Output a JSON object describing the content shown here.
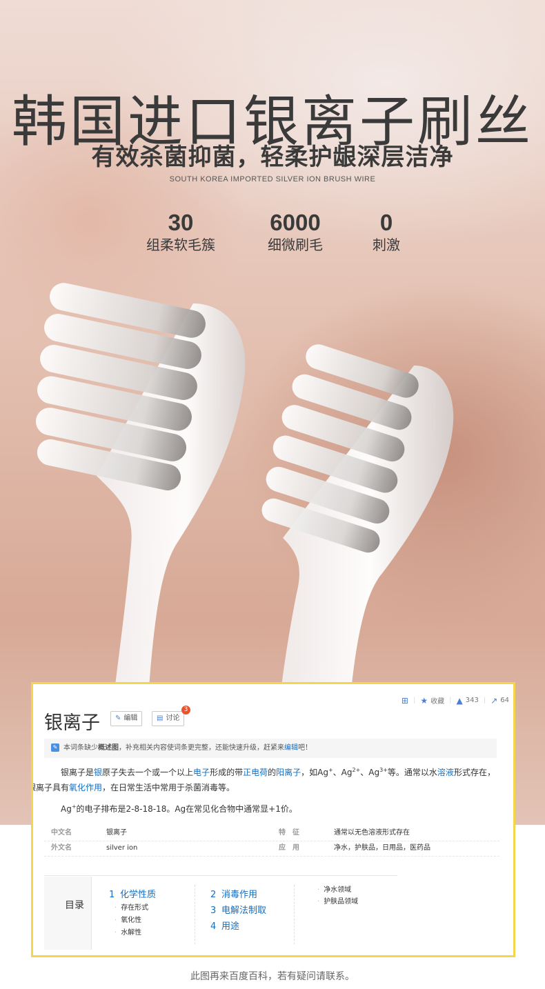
{
  "hero": {
    "headline": "韩国进口银离子刷丝",
    "subheadline": "有效杀菌抑菌，轻柔护龈深层洁净",
    "english_line": "SOUTH KOREA IMPORTED SILVER ION BRUSH WIRE",
    "stats": [
      {
        "value": "30",
        "label": "组柔软毛簇"
      },
      {
        "value": "6000",
        "label": "细微刷毛"
      },
      {
        "value": "0",
        "label": "刺激"
      }
    ]
  },
  "baike": {
    "toolbar": {
      "collect_label": "收藏",
      "likes": "343",
      "shares": "64"
    },
    "title": "银离子",
    "edit_label": "编辑",
    "discuss_label": "讨论",
    "discuss_badge": "3",
    "notice": {
      "p1": "本词条缺少",
      "p2": "概述图",
      "p3": "，补充相关内容使词条更完整，还能快速升级，赶紧来",
      "p4": "编辑",
      "p5": "吧！"
    },
    "para1": {
      "t1": "银离子是",
      "l1": "银",
      "t2": "原子失去一个或一个以上",
      "l2": "电子",
      "t3": "形成的带",
      "l3": "正电荷",
      "t4": "的",
      "l4": "阳离子",
      "t5": "，如Ag",
      "s1": "+",
      "t6": "、Ag",
      "s2": "2+",
      "t7": "、Ag",
      "s3": "3+",
      "t8": "等。通常以水",
      "l5": "溶液",
      "t9": "形式存在，",
      "t10": "银离子具有",
      "l6": "氧化作用",
      "t11": "，在日常生活中常用于杀菌消毒等。"
    },
    "para2": {
      "t1": "Ag",
      "s1": "+",
      "t2": "的电子排布是2-8-18-18。Ag在常见化合物中通常显+1价。"
    },
    "basic_info": {
      "row1": {
        "k1": "中文名",
        "v1": "银离子",
        "k2": "特　征",
        "v2": "通常以无色溶液形式存在"
      },
      "row2": {
        "k1": "外文名",
        "v1": "silver ion",
        "k2": "应　用",
        "v2": "净水，护肤品，日用品，医药品"
      }
    },
    "toc": {
      "heading": "目录",
      "c1": {
        "n": "1",
        "label": "化学性质",
        "subs": [
          "存在形式",
          "氧化性",
          "水解性"
        ]
      },
      "c2": [
        {
          "n": "2",
          "label": "消毒作用"
        },
        {
          "n": "3",
          "label": "电解法制取"
        },
        {
          "n": "4",
          "label": "用途"
        }
      ],
      "c3_subs": [
        "净水领域",
        "护肤品领域"
      ]
    }
  },
  "footer_note": "此图再来百度百科，若有疑问请联系。"
}
